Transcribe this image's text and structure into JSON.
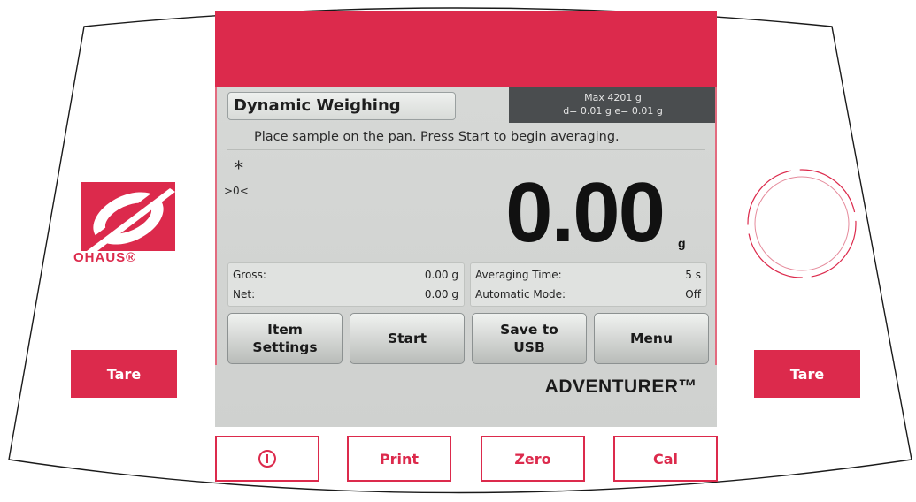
{
  "display": {
    "mode_title": "Dynamic Weighing",
    "capacity": {
      "max": "Max  4201 g",
      "divisions": "d= 0.01 g  e= 0.01 g"
    },
    "instruction": "Place sample on the pan.  Press Start to begin averaging.",
    "stable_indicator": "*",
    "center_zero_indicator": ">0<",
    "weight_value": "0.00",
    "weight_unit": "g",
    "info_left": {
      "rows": [
        {
          "label": "Gross:",
          "value": "0.00 g"
        },
        {
          "label": "Net:",
          "value": "0.00 g"
        }
      ]
    },
    "info_right": {
      "rows": [
        {
          "label": "Averaging Time:",
          "value": "5 s"
        },
        {
          "label": "Automatic Mode:",
          "value": "Off"
        }
      ]
    },
    "soft_buttons": {
      "item_settings": {
        "line1": "Item",
        "line2": "Settings"
      },
      "start": "Start",
      "save_to_usb": {
        "line1": "Save to",
        "line2": "USB"
      },
      "menu": "Menu"
    },
    "brand": "ADVENTURER™"
  },
  "hardware": {
    "logo_text": "OHAUS®",
    "tare_left": "Tare",
    "tare_right": "Tare",
    "keys": {
      "power_icon": "power-icon",
      "print": "Print",
      "zero": "Zero",
      "cal": "Cal"
    }
  },
  "colors": {
    "accent_red": "#dc2a4c",
    "screen_bg": "#d3d5d3",
    "capacity_bg": "#4a4d4f"
  }
}
